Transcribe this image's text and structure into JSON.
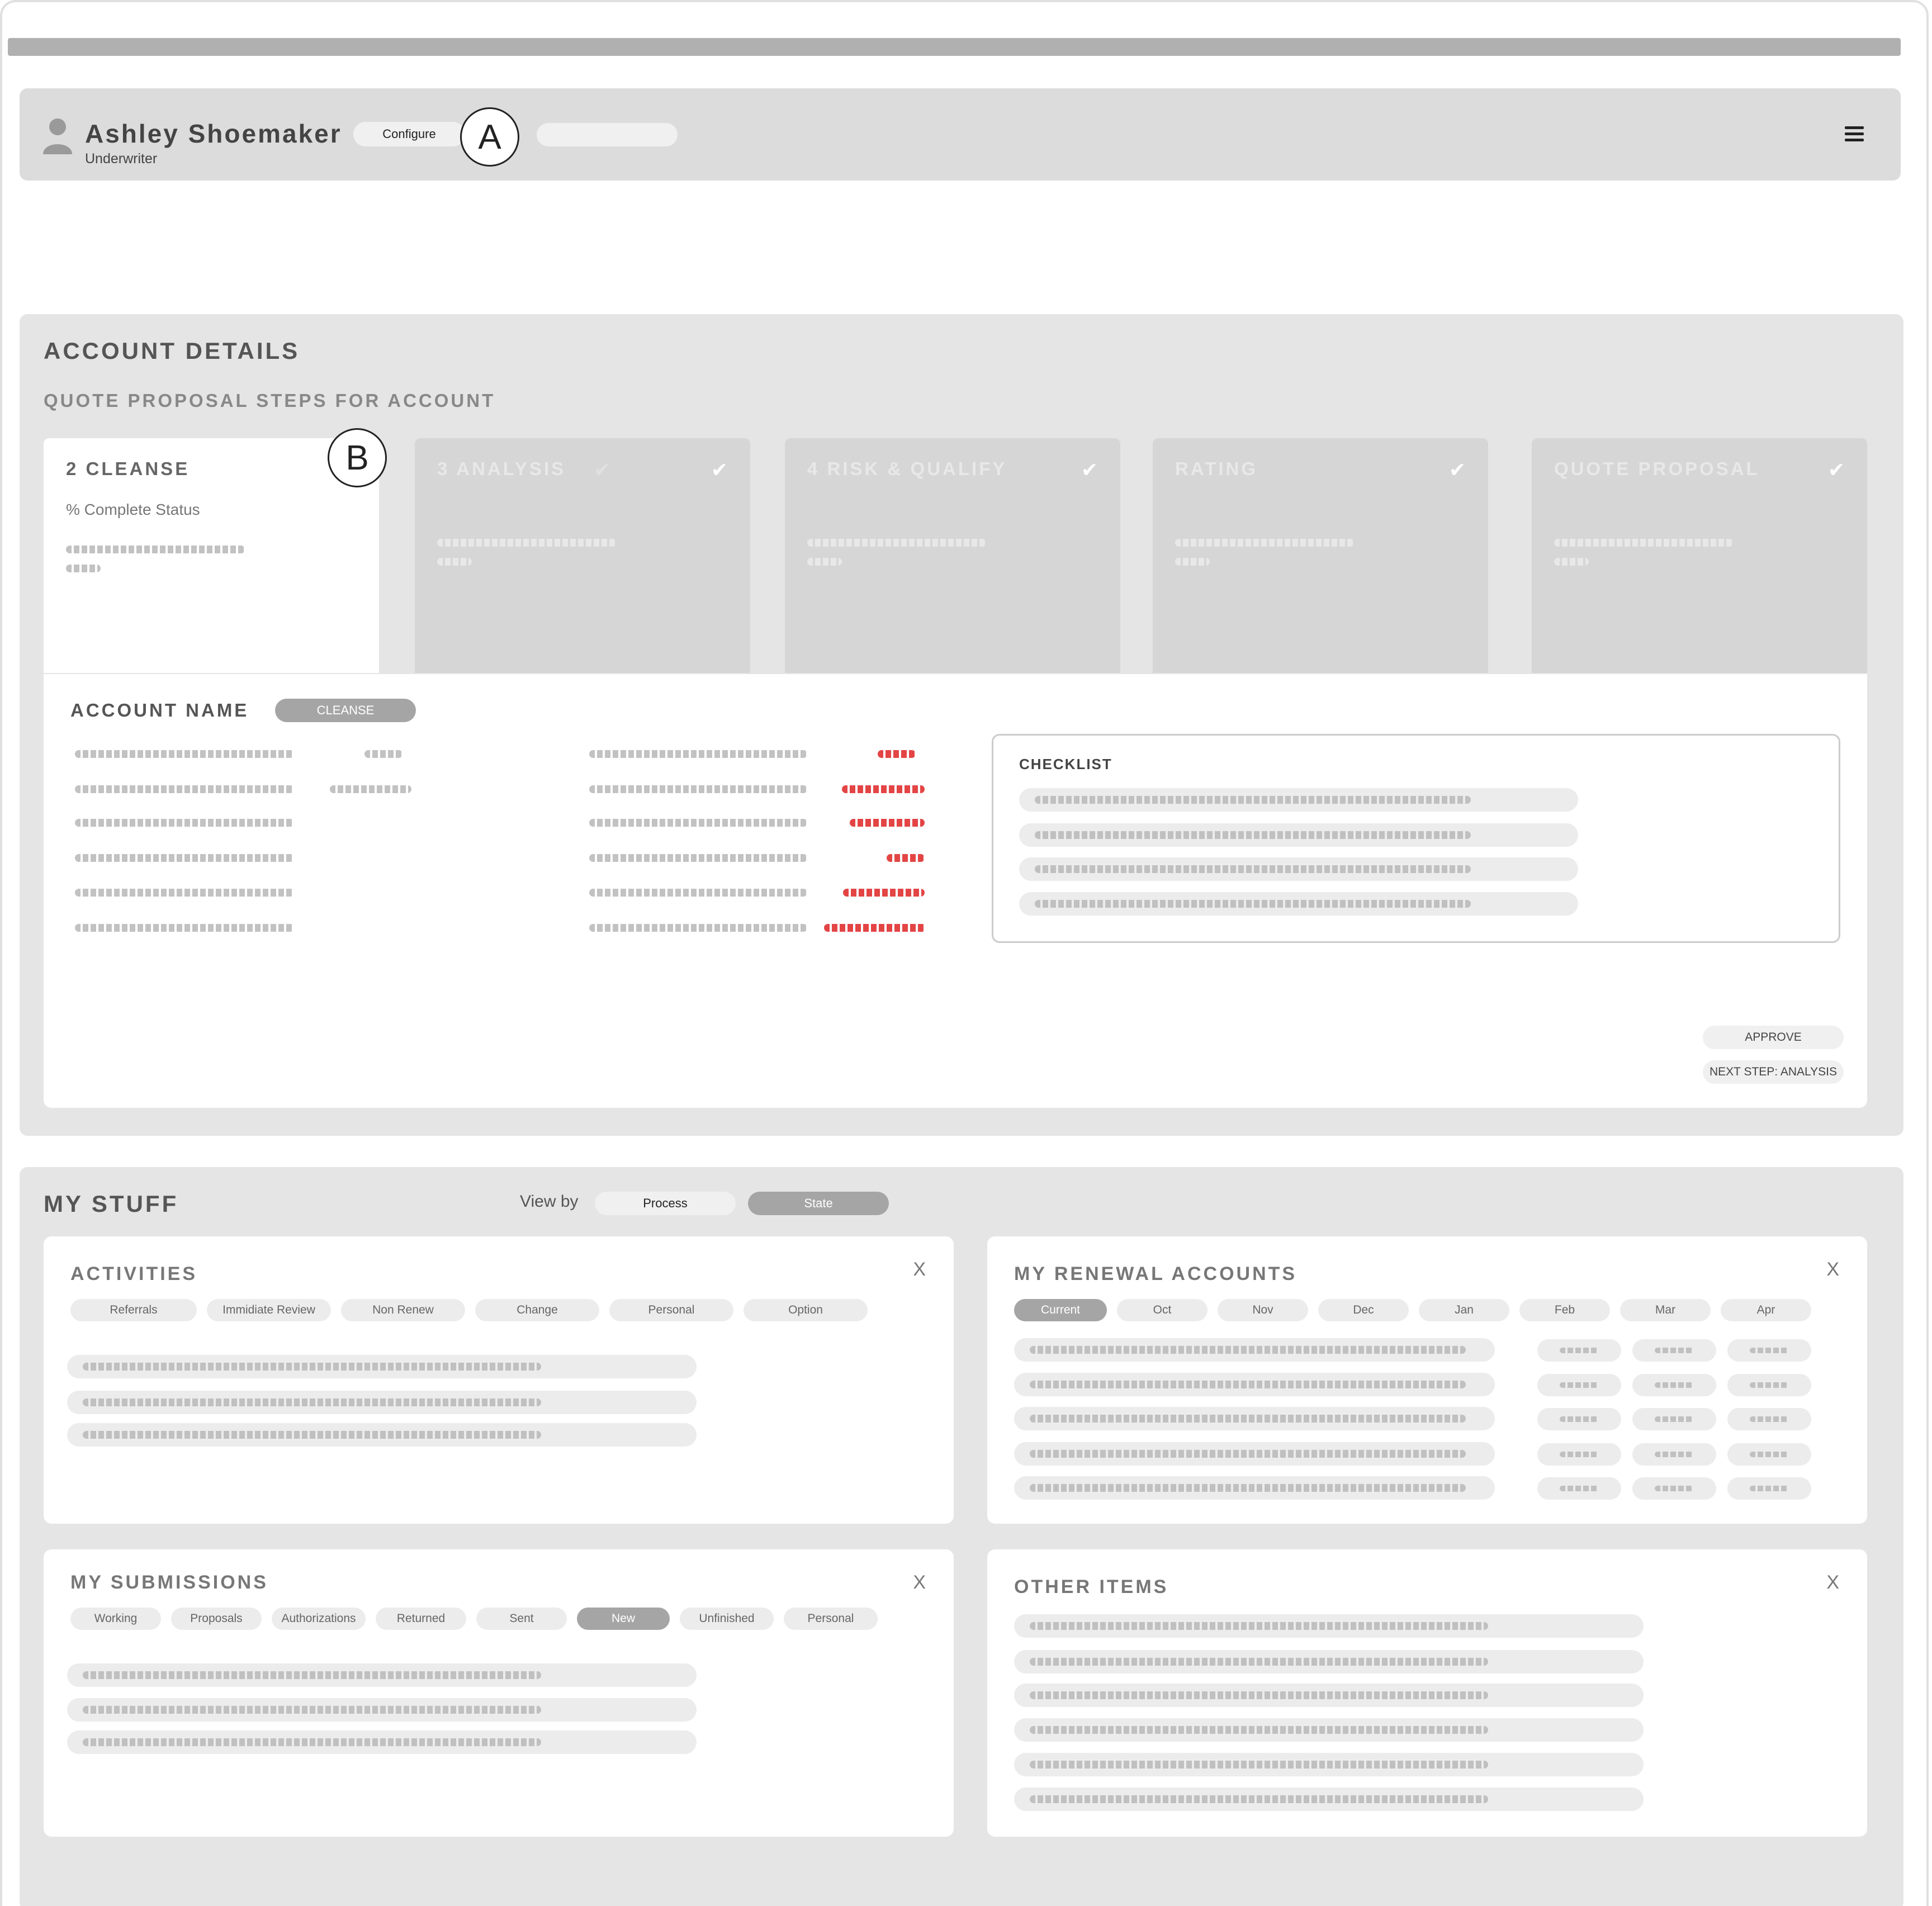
{
  "header": {
    "user_name": "Ashley Shoemaker",
    "user_role": "Underwriter",
    "configure_label": "Configure",
    "callout_a": "A",
    "callout_b": "B"
  },
  "account_details": {
    "title": "ACCOUNT DETAILS",
    "subtitle": "QUOTE PROPOSAL STEPS FOR ACCOUNT",
    "steps": [
      {
        "label": "2 CLEANSE",
        "status": "% Complete Status"
      },
      {
        "label": "3 ANALYSIS"
      },
      {
        "label": "4 RISK & QUALIFY"
      },
      {
        "label": "RATING"
      },
      {
        "label": "QUOTE PROPOSAL"
      }
    ],
    "account_name_label": "ACCOUNT NAME",
    "cleanse_badge": "CLEANSE",
    "checklist_title": "CHECKLIST",
    "approve_label": "APPROVE",
    "next_step_label": "NEXT STEP: ANALYSIS"
  },
  "my_stuff": {
    "title": "MY STUFF",
    "view_by_label": "View by",
    "view_by_options": [
      "Process",
      "State"
    ],
    "selected_view": "State",
    "activities": {
      "title": "ACTIVITIES",
      "close": "X",
      "tabs": [
        "Referrals",
        "Immidiate Review",
        "Non Renew",
        "Change",
        "Personal",
        "Option"
      ]
    },
    "renewals": {
      "title": "MY RENEWAL  ACCOUNTS",
      "close": "X",
      "tabs": [
        "Current",
        "Oct",
        "Nov",
        "Dec",
        "Jan",
        "Feb",
        "Mar",
        "Apr"
      ],
      "selected_tab": "Current"
    },
    "submissions": {
      "title": "MY SUBMISSIONS",
      "close": "X",
      "tabs": [
        "Working",
        "Proposals",
        "Authorizations",
        "Returned",
        "Sent",
        "New",
        "Unfinished",
        "Personal"
      ],
      "selected_tab": "New"
    },
    "other_items": {
      "title": "OTHER ITEMS",
      "close": "X"
    }
  },
  "colors": {
    "panel_bg": "#e5e5e5",
    "selected_pill": "#a5a5a5",
    "warning_text": "#e03030"
  }
}
